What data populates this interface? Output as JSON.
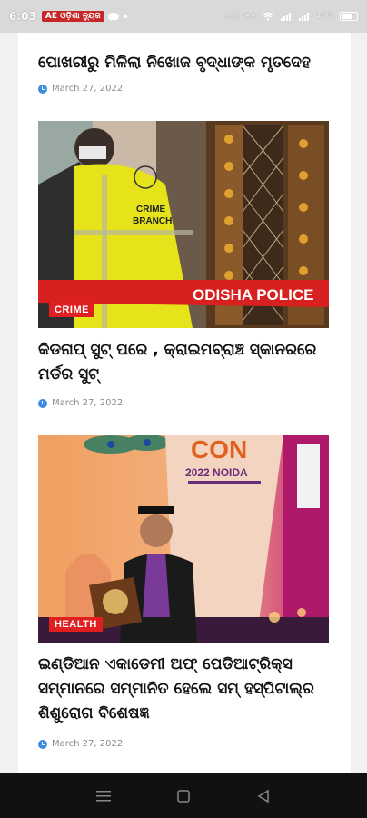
{
  "status_bar": {
    "time": "6:03",
    "notification_badge": "AE ଓଡ଼ିଶା ନ୍ୟୁଜ",
    "right_text": "0.10 KB/S",
    "battery": "48%"
  },
  "articles": [
    {
      "title": "ପୋଖରୀରୁ ମିଳିଲା ନିଖୋଜ ବୃଦ୍ଧାଙ୍କ ମୃତଦେହ",
      "date": "March 27, 2022"
    },
    {
      "title": "କିଡନାପ୍ ସୁଟ୍ ପରେ , କ୍ରାଇମବ୍ରାଞ୍ଚ ସ୍କାନରରେ ମର୍ଡର ସୁଟ୍",
      "date": "March 27, 2022",
      "category": "CRIME",
      "image": {
        "vest_text": "CRIME BRANCH",
        "tape_text": "ODISHA POLICE"
      }
    },
    {
      "title": "ଇଣ୍ଡିଆନ ଏକାଡେମୀ ଅଫ୍ ପେଡିଆଟ୍ରିକ୍ସ ସମ୍ମାନରେ ସମ୍ମାନିତ ହେଲେ ସମ୍ ହସ୍ପିଟାଲ୍‌ର ଶିଶୁରୋଗ ବିଶେଷଜ୍ଞ",
      "date": "March 27, 2022",
      "category": "HEALTH",
      "image": {
        "banner_big": "CON",
        "banner_year": "2022 NOIDA"
      }
    }
  ],
  "colors": {
    "badge_red": "#e02020",
    "clock_blue": "#3a8dde"
  }
}
